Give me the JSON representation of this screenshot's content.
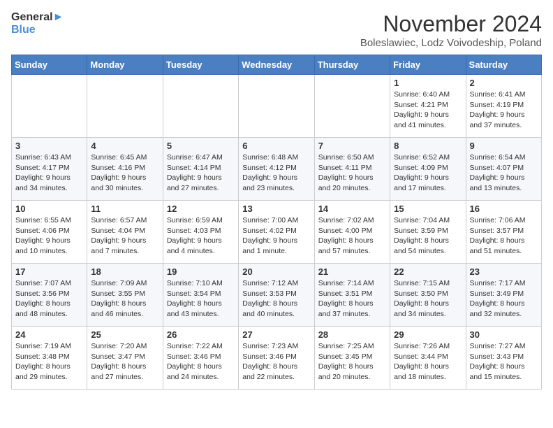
{
  "header": {
    "logo_line1": "General",
    "logo_line2": "Blue",
    "month_title": "November 2024",
    "location": "Boleslawiec, Lodz Voivodeship, Poland"
  },
  "days_of_week": [
    "Sunday",
    "Monday",
    "Tuesday",
    "Wednesday",
    "Thursday",
    "Friday",
    "Saturday"
  ],
  "weeks": [
    [
      {
        "day": "",
        "info": ""
      },
      {
        "day": "",
        "info": ""
      },
      {
        "day": "",
        "info": ""
      },
      {
        "day": "",
        "info": ""
      },
      {
        "day": "",
        "info": ""
      },
      {
        "day": "1",
        "info": "Sunrise: 6:40 AM\nSunset: 4:21 PM\nDaylight: 9 hours\nand 41 minutes."
      },
      {
        "day": "2",
        "info": "Sunrise: 6:41 AM\nSunset: 4:19 PM\nDaylight: 9 hours\nand 37 minutes."
      }
    ],
    [
      {
        "day": "3",
        "info": "Sunrise: 6:43 AM\nSunset: 4:17 PM\nDaylight: 9 hours\nand 34 minutes."
      },
      {
        "day": "4",
        "info": "Sunrise: 6:45 AM\nSunset: 4:16 PM\nDaylight: 9 hours\nand 30 minutes."
      },
      {
        "day": "5",
        "info": "Sunrise: 6:47 AM\nSunset: 4:14 PM\nDaylight: 9 hours\nand 27 minutes."
      },
      {
        "day": "6",
        "info": "Sunrise: 6:48 AM\nSunset: 4:12 PM\nDaylight: 9 hours\nand 23 minutes."
      },
      {
        "day": "7",
        "info": "Sunrise: 6:50 AM\nSunset: 4:11 PM\nDaylight: 9 hours\nand 20 minutes."
      },
      {
        "day": "8",
        "info": "Sunrise: 6:52 AM\nSunset: 4:09 PM\nDaylight: 9 hours\nand 17 minutes."
      },
      {
        "day": "9",
        "info": "Sunrise: 6:54 AM\nSunset: 4:07 PM\nDaylight: 9 hours\nand 13 minutes."
      }
    ],
    [
      {
        "day": "10",
        "info": "Sunrise: 6:55 AM\nSunset: 4:06 PM\nDaylight: 9 hours\nand 10 minutes."
      },
      {
        "day": "11",
        "info": "Sunrise: 6:57 AM\nSunset: 4:04 PM\nDaylight: 9 hours\nand 7 minutes."
      },
      {
        "day": "12",
        "info": "Sunrise: 6:59 AM\nSunset: 4:03 PM\nDaylight: 9 hours\nand 4 minutes."
      },
      {
        "day": "13",
        "info": "Sunrise: 7:00 AM\nSunset: 4:02 PM\nDaylight: 9 hours\nand 1 minute."
      },
      {
        "day": "14",
        "info": "Sunrise: 7:02 AM\nSunset: 4:00 PM\nDaylight: 8 hours\nand 57 minutes."
      },
      {
        "day": "15",
        "info": "Sunrise: 7:04 AM\nSunset: 3:59 PM\nDaylight: 8 hours\nand 54 minutes."
      },
      {
        "day": "16",
        "info": "Sunrise: 7:06 AM\nSunset: 3:57 PM\nDaylight: 8 hours\nand 51 minutes."
      }
    ],
    [
      {
        "day": "17",
        "info": "Sunrise: 7:07 AM\nSunset: 3:56 PM\nDaylight: 8 hours\nand 48 minutes."
      },
      {
        "day": "18",
        "info": "Sunrise: 7:09 AM\nSunset: 3:55 PM\nDaylight: 8 hours\nand 46 minutes."
      },
      {
        "day": "19",
        "info": "Sunrise: 7:10 AM\nSunset: 3:54 PM\nDaylight: 8 hours\nand 43 minutes."
      },
      {
        "day": "20",
        "info": "Sunrise: 7:12 AM\nSunset: 3:53 PM\nDaylight: 8 hours\nand 40 minutes."
      },
      {
        "day": "21",
        "info": "Sunrise: 7:14 AM\nSunset: 3:51 PM\nDaylight: 8 hours\nand 37 minutes."
      },
      {
        "day": "22",
        "info": "Sunrise: 7:15 AM\nSunset: 3:50 PM\nDaylight: 8 hours\nand 34 minutes."
      },
      {
        "day": "23",
        "info": "Sunrise: 7:17 AM\nSunset: 3:49 PM\nDaylight: 8 hours\nand 32 minutes."
      }
    ],
    [
      {
        "day": "24",
        "info": "Sunrise: 7:19 AM\nSunset: 3:48 PM\nDaylight: 8 hours\nand 29 minutes."
      },
      {
        "day": "25",
        "info": "Sunrise: 7:20 AM\nSunset: 3:47 PM\nDaylight: 8 hours\nand 27 minutes."
      },
      {
        "day": "26",
        "info": "Sunrise: 7:22 AM\nSunset: 3:46 PM\nDaylight: 8 hours\nand 24 minutes."
      },
      {
        "day": "27",
        "info": "Sunrise: 7:23 AM\nSunset: 3:46 PM\nDaylight: 8 hours\nand 22 minutes."
      },
      {
        "day": "28",
        "info": "Sunrise: 7:25 AM\nSunset: 3:45 PM\nDaylight: 8 hours\nand 20 minutes."
      },
      {
        "day": "29",
        "info": "Sunrise: 7:26 AM\nSunset: 3:44 PM\nDaylight: 8 hours\nand 18 minutes."
      },
      {
        "day": "30",
        "info": "Sunrise: 7:27 AM\nSunset: 3:43 PM\nDaylight: 8 hours\nand 15 minutes."
      }
    ]
  ]
}
